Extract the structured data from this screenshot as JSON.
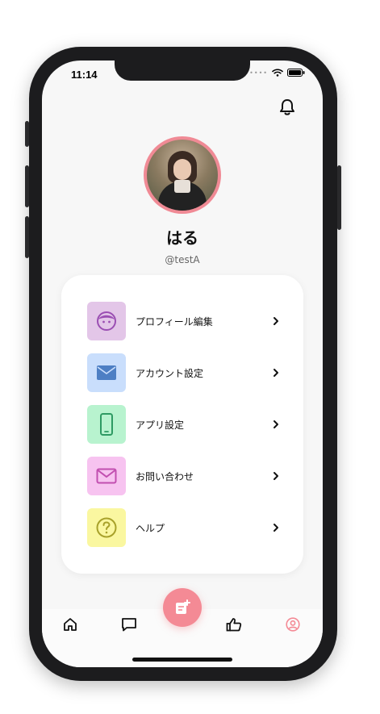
{
  "status_bar": {
    "time": "11:14"
  },
  "profile": {
    "name": "はる",
    "handle": "@testA"
  },
  "menu": {
    "items": [
      {
        "label": "プロフィール編集",
        "icon": "face-icon",
        "bg": "#e3c6e8",
        "fg": "#9b4fb3"
      },
      {
        "label": "アカウント設定",
        "icon": "mail-icon",
        "bg": "#c9defc",
        "fg": "#4d7fc4"
      },
      {
        "label": "アプリ設定",
        "icon": "smartphone-icon",
        "bg": "#b8f3cf",
        "fg": "#2e9a63"
      },
      {
        "label": "お問い合わせ",
        "icon": "mail-outline-icon",
        "bg": "#f7c3f0",
        "fg": "#c24fb0"
      },
      {
        "label": "ヘルプ",
        "icon": "help-circle-icon",
        "bg": "#faf7a0",
        "fg": "#a8a12a"
      }
    ]
  },
  "tab_bar": {
    "items": [
      "home-icon",
      "chat-icon",
      "compose-icon",
      "thumbs-up-icon",
      "account-icon"
    ],
    "accent": "#f48a95"
  }
}
